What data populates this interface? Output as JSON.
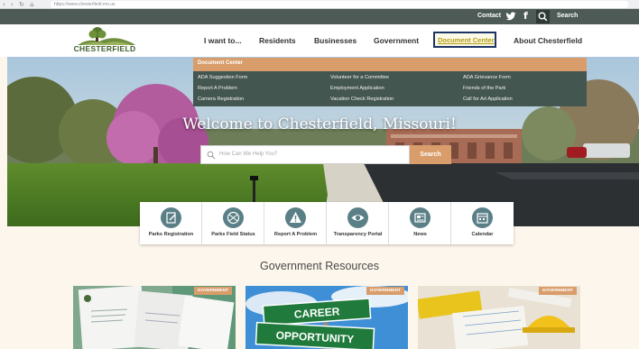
{
  "browser": {
    "url": "https://www.chesterfield.mo.us"
  },
  "utility": {
    "contact": "Contact",
    "search": "Search"
  },
  "logo": {
    "text": "CHESTERFIELD"
  },
  "nav": {
    "items": [
      {
        "label": "I want to..."
      },
      {
        "label": "Residents"
      },
      {
        "label": "Businesses"
      },
      {
        "label": "Government"
      },
      {
        "label": "Document Center"
      },
      {
        "label": "About Chesterfield"
      }
    ]
  },
  "dropdown": {
    "title": "Document Center",
    "col1": [
      "ADA Suggestion Form",
      "Report A Problem",
      "Camera Registration"
    ],
    "col2": [
      "Volunteer for a Committee",
      "Employment Application",
      "Vacation Check Registration"
    ],
    "col3": [
      "ADA Grievance Form",
      "Friends of the Park",
      "Call for Art Application"
    ]
  },
  "hero": {
    "title": "Welcome to Chesterfield, Missouri!",
    "search_placeholder": "How Can We Help You?",
    "search_button": "Search"
  },
  "quick_links": [
    {
      "label": "Parks Registration",
      "icon": "pencil-icon"
    },
    {
      "label": "Parks Field Status",
      "icon": "ball-icon"
    },
    {
      "label": "Report A Problem",
      "icon": "warning-icon"
    },
    {
      "label": "Transparency Portal",
      "icon": "eye-icon"
    },
    {
      "label": "News",
      "icon": "news-icon"
    },
    {
      "label": "Calendar",
      "icon": "calendar-icon"
    }
  ],
  "resources": {
    "title": "Government Resources",
    "cards": [
      {
        "badge": "GOVERNMENT"
      },
      {
        "badge": "GOVERNMENT",
        "sign_top": "CAREER",
        "sign_bottom": "OPPORTUNITY"
      },
      {
        "badge": "GOVERNMENT"
      }
    ]
  },
  "colors": {
    "accent": "#d89d6a",
    "dark": "#4d5a56",
    "highlight_border": "#1c3466"
  }
}
